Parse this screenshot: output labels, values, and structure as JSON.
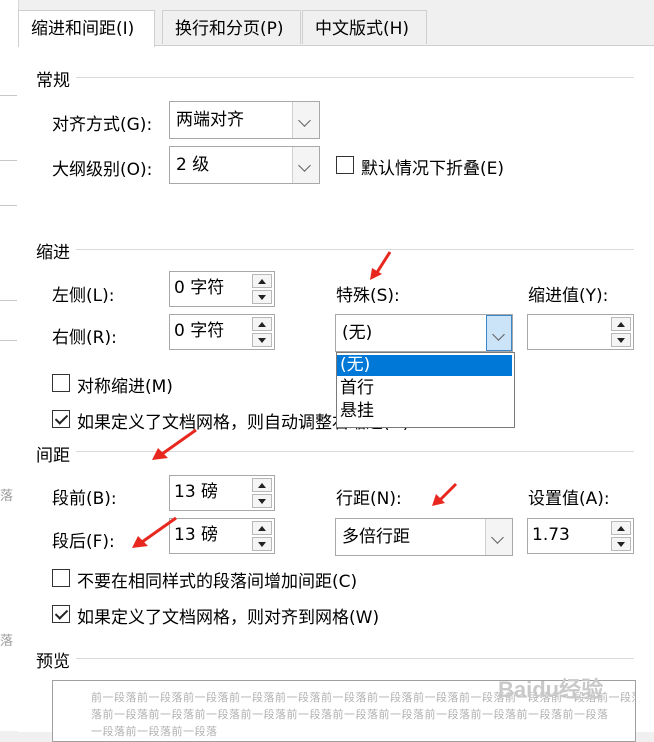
{
  "tabs": [
    {
      "label": "缩进和间距(I)",
      "active": true
    },
    {
      "label": "换行和分页(P)",
      "active": false
    },
    {
      "label": "中文版式(H)",
      "active": false
    }
  ],
  "general": {
    "section_title": "常规",
    "alignment_label": "对齐方式(G):",
    "alignment_value": "两端对齐",
    "outline_label": "大纲级别(O):",
    "outline_value": "2 级",
    "collapse_label": "默认情况下折叠(E)",
    "collapse_checked": false
  },
  "indent": {
    "section_title": "缩进",
    "left_label": "左侧(L):",
    "left_value": "0 字符",
    "right_label": "右侧(R):",
    "right_value": "0 字符",
    "special_label": "特殊(S):",
    "special_value": "(无)",
    "special_options": [
      "(无)",
      "首行",
      "悬挂"
    ],
    "by_label": "缩进值(Y):",
    "by_value": "",
    "mirror_label": "对称缩进(M)",
    "mirror_checked": false,
    "grid_label": "如果定义了文档网格，则自动调整右缩进(D)",
    "grid_checked": true
  },
  "spacing": {
    "section_title": "间距",
    "before_label": "段前(B):",
    "before_value": "13 磅",
    "after_label": "段后(F):",
    "after_value": "13 磅",
    "line_label": "行距(N):",
    "line_value": "多倍行距",
    "at_label": "设置值(A):",
    "at_value": "1.73",
    "no_space_label": "不要在相同样式的段落间增加间距(C)",
    "no_space_checked": false,
    "snap_label": "如果定义了文档网格，则对齐到网格(W)",
    "snap_checked": true
  },
  "preview": {
    "section_title": "预览",
    "line1": "前一段落前一段落前一段落前一段落前一段落前一段落前一段落前一段落前一段落前一段落前一段落前一段落",
    "line2": "落前一段落前一段落前一段落前一段落前一段落前一段落前一段落前一段落前一段落前一段落前一段落",
    "line3": "一段落前一段落前一段落"
  },
  "watermark": "Baidu经验",
  "colors": {
    "accent": "#0078d7",
    "arrow": "#e8281e"
  }
}
